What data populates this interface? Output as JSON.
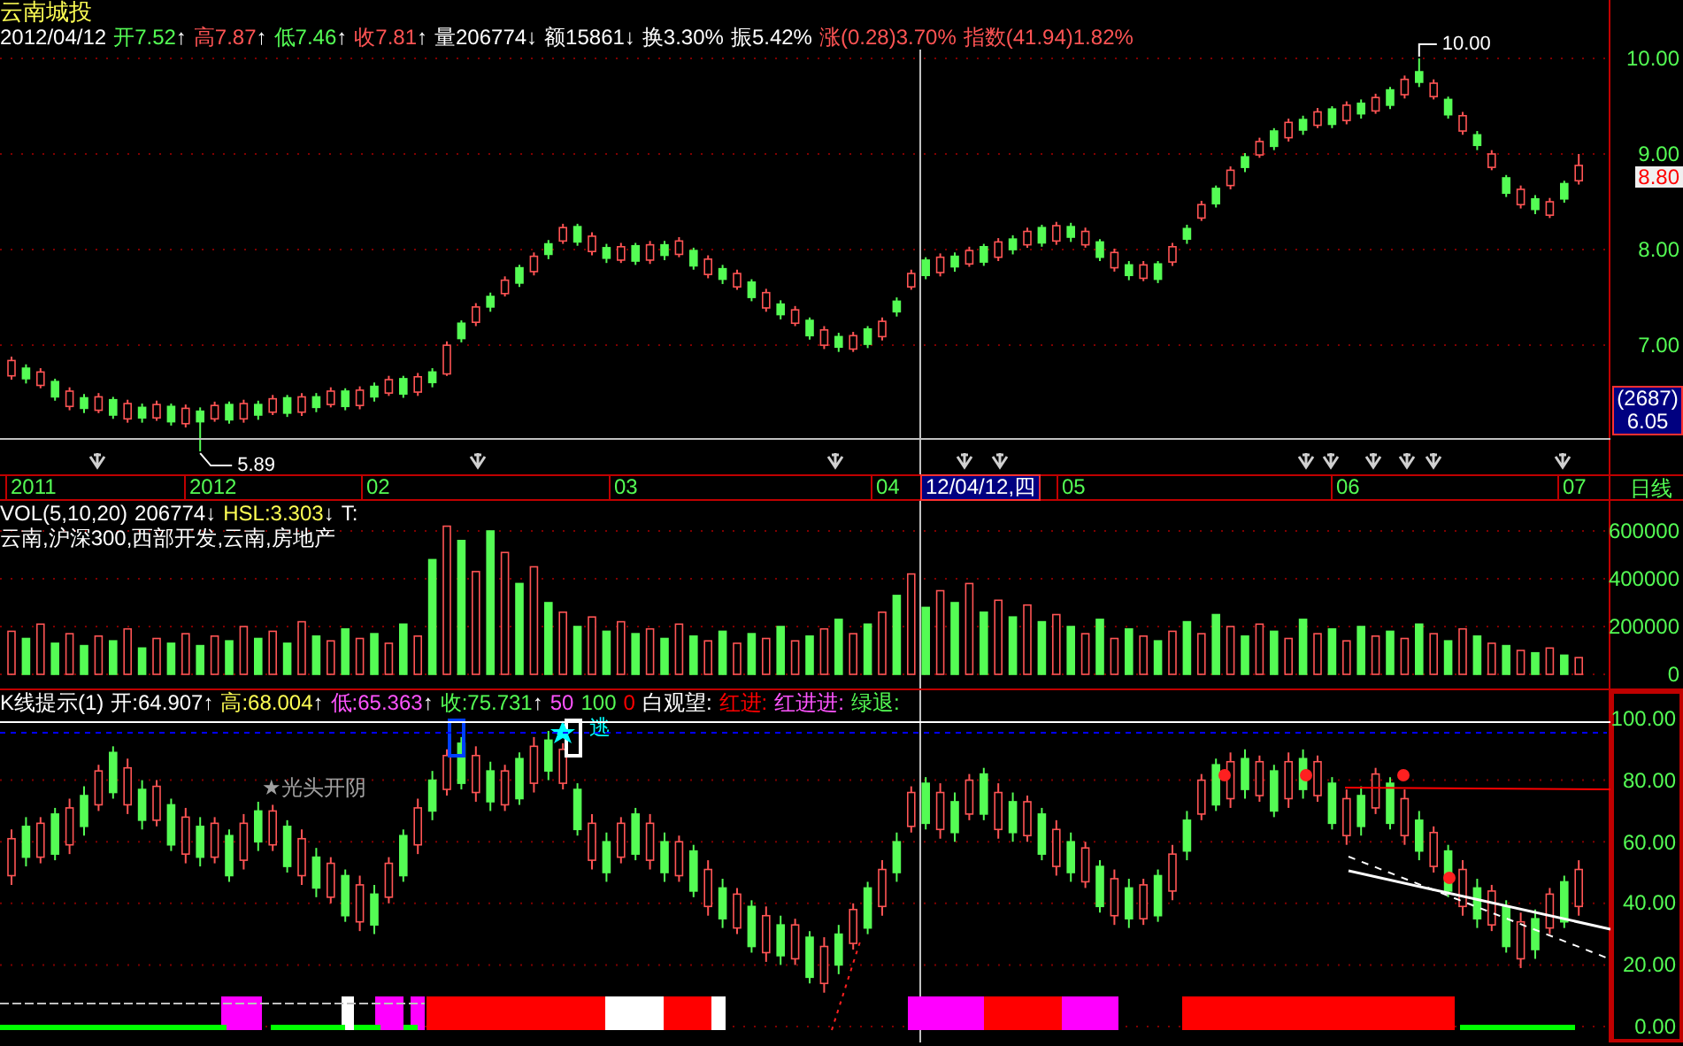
{
  "title": "云南城投",
  "quote": [
    {
      "text": "2012/04/12",
      "color": "#ffffff"
    },
    {
      "text": "开7.52",
      "color": "#54fc54",
      "arrow": "↑"
    },
    {
      "text": "高7.87",
      "color": "#ff5454",
      "arrow": "↑"
    },
    {
      "text": "低7.46",
      "color": "#54fc54",
      "arrow": "↑"
    },
    {
      "text": "收7.81",
      "color": "#ff5454",
      "arrow": "↑"
    },
    {
      "text": "量206774",
      "color": "#ffffff",
      "arrow": "↓"
    },
    {
      "text": "额15861",
      "color": "#ffffff",
      "arrow": "↓"
    },
    {
      "text": "换3.30%",
      "color": "#ffffff"
    },
    {
      "text": "振5.42%",
      "color": "#ffffff"
    },
    {
      "text": "涨(0.28)3.70%",
      "color": "#ff5454"
    },
    {
      "text": "指数(41.94)1.82%",
      "color": "#ff5454"
    }
  ],
  "price": {
    "current": "8.80",
    "info_box": {
      "count": "(2687)",
      "value": "6.05"
    },
    "high_label": "10.00",
    "low_label": "5.89",
    "chart_data": {
      "type": "candlestick",
      "grid": true,
      "ylim": [
        5.65,
        10.61
      ],
      "yticks": [
        {
          "value": 10,
          "label": "10.00"
        },
        {
          "value": 9,
          "label": "9.00"
        },
        {
          "value": 8,
          "label": "8.00"
        },
        {
          "value": 7,
          "label": "7.00"
        }
      ],
      "ohlc": [
        [
          6.68,
          6.88,
          6.64,
          6.84
        ],
        [
          6.76,
          6.8,
          6.6,
          6.65
        ],
        [
          6.58,
          6.76,
          6.55,
          6.72
        ],
        [
          6.62,
          6.65,
          6.42,
          6.46
        ],
        [
          6.36,
          6.56,
          6.32,
          6.52
        ],
        [
          6.45,
          6.49,
          6.29,
          6.34
        ],
        [
          6.32,
          6.5,
          6.29,
          6.46
        ],
        [
          6.43,
          6.46,
          6.23,
          6.27
        ],
        [
          6.23,
          6.43,
          6.19,
          6.39
        ],
        [
          6.35,
          6.39,
          6.19,
          6.24
        ],
        [
          6.24,
          6.42,
          6.21,
          6.38
        ],
        [
          6.36,
          6.39,
          6.16,
          6.2
        ],
        [
          6.18,
          6.38,
          6.14,
          6.34
        ],
        [
          6.31,
          6.35,
          5.89,
          6.2
        ],
        [
          6.23,
          6.41,
          6.2,
          6.37
        ],
        [
          6.38,
          6.41,
          6.18,
          6.22
        ],
        [
          6.23,
          6.43,
          6.19,
          6.39
        ],
        [
          6.38,
          6.42,
          6.22,
          6.27
        ],
        [
          6.3,
          6.48,
          6.27,
          6.44
        ],
        [
          6.45,
          6.48,
          6.25,
          6.29
        ],
        [
          6.3,
          6.5,
          6.26,
          6.46
        ],
        [
          6.46,
          6.5,
          6.3,
          6.35
        ],
        [
          6.38,
          6.56,
          6.35,
          6.52
        ],
        [
          6.52,
          6.55,
          6.32,
          6.36
        ],
        [
          6.37,
          6.57,
          6.33,
          6.53
        ],
        [
          6.57,
          6.61,
          6.41,
          6.46
        ],
        [
          6.5,
          6.68,
          6.47,
          6.64
        ],
        [
          6.65,
          6.68,
          6.45,
          6.49
        ],
        [
          6.51,
          6.71,
          6.47,
          6.67
        ],
        [
          6.72,
          6.76,
          6.56,
          6.61
        ],
        [
          6.7,
          7.04,
          6.68,
          7.0
        ],
        [
          7.23,
          7.26,
          7.03,
          7.07
        ],
        [
          7.24,
          7.44,
          7.2,
          7.4
        ],
        [
          7.51,
          7.55,
          7.35,
          7.4
        ],
        [
          7.54,
          7.72,
          7.51,
          7.68
        ],
        [
          7.81,
          7.84,
          7.61,
          7.65
        ],
        [
          7.77,
          7.97,
          7.73,
          7.93
        ],
        [
          8.06,
          8.1,
          7.9,
          7.95
        ],
        [
          8.09,
          8.27,
          8.06,
          8.23
        ],
        [
          8.24,
          8.27,
          8.04,
          8.08
        ],
        [
          7.98,
          8.18,
          7.94,
          8.14
        ],
        [
          8.02,
          8.06,
          7.86,
          7.91
        ],
        [
          7.89,
          8.07,
          7.86,
          8.03
        ],
        [
          8.04,
          8.07,
          7.84,
          7.88
        ],
        [
          7.89,
          8.09,
          7.85,
          8.05
        ],
        [
          8.05,
          8.09,
          7.89,
          7.94
        ],
        [
          7.95,
          8.13,
          7.92,
          8.09
        ],
        [
          7.99,
          8.02,
          7.79,
          7.83
        ],
        [
          7.74,
          7.94,
          7.7,
          7.9
        ],
        [
          7.8,
          7.84,
          7.64,
          7.69
        ],
        [
          7.61,
          7.79,
          7.58,
          7.75
        ],
        [
          7.66,
          7.69,
          7.46,
          7.5
        ],
        [
          7.39,
          7.59,
          7.35,
          7.55
        ],
        [
          7.43,
          7.47,
          7.27,
          7.32
        ],
        [
          7.23,
          7.41,
          7.2,
          7.37
        ],
        [
          7.26,
          7.29,
          7.06,
          7.1
        ],
        [
          7.0,
          7.2,
          6.96,
          7.16
        ],
        [
          7.09,
          7.13,
          6.93,
          6.98
        ],
        [
          6.96,
          7.14,
          6.93,
          7.1
        ],
        [
          7.17,
          7.2,
          6.97,
          7.01
        ],
        [
          7.09,
          7.29,
          7.05,
          7.25
        ],
        [
          7.46,
          7.5,
          7.3,
          7.35
        ],
        [
          7.61,
          7.79,
          7.58,
          7.75
        ],
        [
          7.89,
          7.92,
          7.69,
          7.73
        ],
        [
          7.76,
          7.96,
          7.72,
          7.92
        ],
        [
          7.93,
          7.97,
          7.77,
          7.82
        ],
        [
          7.85,
          8.03,
          7.82,
          7.99
        ],
        [
          8.03,
          8.06,
          7.83,
          7.87
        ],
        [
          7.92,
          8.12,
          7.88,
          8.08
        ],
        [
          8.11,
          8.15,
          7.95,
          8.0
        ],
        [
          8.05,
          8.23,
          8.02,
          8.19
        ],
        [
          8.23,
          8.26,
          8.03,
          8.07
        ],
        [
          8.09,
          8.29,
          8.05,
          8.25
        ],
        [
          8.24,
          8.28,
          8.08,
          8.13
        ],
        [
          8.05,
          8.23,
          8.02,
          8.19
        ],
        [
          8.08,
          8.11,
          7.88,
          7.92
        ],
        [
          7.81,
          8.01,
          7.77,
          7.97
        ],
        [
          7.84,
          7.88,
          7.68,
          7.73
        ],
        [
          7.7,
          7.88,
          7.67,
          7.84
        ],
        [
          7.85,
          7.88,
          7.65,
          7.69
        ],
        [
          7.87,
          8.07,
          7.83,
          8.03
        ],
        [
          8.22,
          8.26,
          8.06,
          8.11
        ],
        [
          8.33,
          8.51,
          8.3,
          8.47
        ],
        [
          8.64,
          8.67,
          8.44,
          8.48
        ],
        [
          8.67,
          8.87,
          8.63,
          8.83
        ],
        [
          8.97,
          9.01,
          8.81,
          8.86
        ],
        [
          8.99,
          9.17,
          8.96,
          9.13
        ],
        [
          9.24,
          9.27,
          9.04,
          9.08
        ],
        [
          9.17,
          9.37,
          9.13,
          9.33
        ],
        [
          9.36,
          9.4,
          9.2,
          9.25
        ],
        [
          9.3,
          9.48,
          9.27,
          9.44
        ],
        [
          9.47,
          9.5,
          9.27,
          9.31
        ],
        [
          9.35,
          9.55,
          9.31,
          9.51
        ],
        [
          9.53,
          9.57,
          9.37,
          9.42
        ],
        [
          9.45,
          9.63,
          9.42,
          9.59
        ],
        [
          9.67,
          9.7,
          9.47,
          9.51
        ],
        [
          9.62,
          9.82,
          9.58,
          9.78
        ],
        [
          9.86,
          10.0,
          9.7,
          9.75
        ],
        [
          9.6,
          9.78,
          9.57,
          9.74
        ],
        [
          9.57,
          9.6,
          9.37,
          9.41
        ],
        [
          9.24,
          9.44,
          9.2,
          9.4
        ],
        [
          9.2,
          9.24,
          9.04,
          9.09
        ],
        [
          8.86,
          9.04,
          8.83,
          9.0
        ],
        [
          8.75,
          8.78,
          8.55,
          8.59
        ],
        [
          8.47,
          8.67,
          8.43,
          8.63
        ],
        [
          8.53,
          8.57,
          8.37,
          8.42
        ],
        [
          8.36,
          8.54,
          8.33,
          8.5
        ],
        [
          8.69,
          8.72,
          8.49,
          8.53
        ],
        [
          8.72,
          9.0,
          8.68,
          8.88
        ]
      ]
    }
  },
  "date_axis": {
    "labels": [
      "2011",
      "2012",
      "02",
      "03",
      "04",
      "05",
      "06",
      "07"
    ],
    "cursor": "12/04/12,四",
    "period": "日线"
  },
  "volume": {
    "header": [
      {
        "text": "VOL(5,10,20)",
        "color": "#ffffff"
      },
      {
        "text": "206774",
        "color": "#ffffff",
        "arrow": "↓"
      },
      {
        "text": "HSL:3.303",
        "color": "#ffff54",
        "arrow": "↓"
      },
      {
        "text": "T:",
        "color": "#ffffff"
      }
    ],
    "sectors": "云南,沪深300,西部开发,云南,房地产",
    "chart_data": {
      "type": "bar",
      "grid": true,
      "ylim": [
        -59259,
        725926
      ],
      "yticks": [
        {
          "value": 600000,
          "label": "600000"
        },
        {
          "value": 400000,
          "label": "400000"
        },
        {
          "value": 200000,
          "label": "200000"
        },
        {
          "value": 0,
          "label": "0"
        }
      ],
      "values": [
        180000,
        150000,
        210000,
        130000,
        170000,
        120000,
        160000,
        140000,
        190000,
        110000,
        150000,
        130000,
        170000,
        120000,
        160000,
        140000,
        200000,
        150000,
        180000,
        130000,
        220000,
        160000,
        140000,
        190000,
        150000,
        170000,
        130000,
        210000,
        160000,
        480000,
        620000,
        560000,
        430000,
        600000,
        510000,
        380000,
        450000,
        300000,
        260000,
        200000,
        240000,
        180000,
        220000,
        170000,
        190000,
        150000,
        210000,
        160000,
        140000,
        180000,
        130000,
        170000,
        150000,
        200000,
        140000,
        160000,
        190000,
        230000,
        170000,
        210000,
        260000,
        330000,
        420000,
        280000,
        350000,
        300000,
        380000,
        260000,
        310000,
        240000,
        290000,
        220000,
        250000,
        200000,
        170000,
        230000,
        150000,
        190000,
        160000,
        140000,
        180000,
        220000,
        170000,
        250000,
        200000,
        160000,
        210000,
        180000,
        150000,
        230000,
        170000,
        190000,
        140000,
        200000,
        160000,
        180000,
        150000,
        210000,
        170000,
        140000,
        190000,
        160000,
        130000,
        120000,
        100000,
        90000,
        110000,
        80000,
        70000
      ]
    }
  },
  "indicator": {
    "header": [
      {
        "text": "K线提示(1)",
        "color": "#ffffff"
      },
      {
        "text": "开:64.907",
        "color": "#ffffff",
        "arrow": "↑"
      },
      {
        "text": "高:68.004",
        "color": "#ffff54",
        "arrow": "↑"
      },
      {
        "text": "低:65.363",
        "color": "#ff54ff",
        "arrow": "↑"
      },
      {
        "text": "收:75.731",
        "color": "#54fc54",
        "arrow": "↑"
      },
      {
        "text": "50",
        "color": "#ff54ff"
      },
      {
        "text": "100",
        "color": "#54fc54"
      },
      {
        "text": "0",
        "color": "#ff0000"
      },
      {
        "text": "白观望:",
        "color": "#ffffff"
      },
      {
        "text": "红进:",
        "color": "#ff0000"
      },
      {
        "text": "红进进:",
        "color": "#ff54ff"
      },
      {
        "text": "绿退:",
        "color": "#54fc54"
      }
    ],
    "pattern_label": "★光头开阴",
    "signal_label": "逃",
    "chart_data": {
      "type": "candlestick",
      "grid": true,
      "ylim": [
        -5.17,
        109.2
      ],
      "yticks": [
        {
          "value": 100,
          "label": "100.00"
        },
        {
          "value": 80,
          "label": "80.00"
        },
        {
          "value": 60,
          "label": "60.00"
        },
        {
          "value": 40,
          "label": "40.00"
        },
        {
          "value": 20,
          "label": "20.00"
        },
        {
          "value": 0,
          "label": "0.00"
        }
      ],
      "ohlc": [
        [
          49,
          64,
          46,
          61
        ],
        [
          65,
          68,
          52,
          55
        ],
        [
          55,
          68,
          53,
          66
        ],
        [
          69,
          71,
          54,
          56
        ],
        [
          59,
          74,
          56,
          71
        ],
        [
          75,
          78,
          62,
          65
        ],
        [
          72,
          85,
          70,
          83
        ],
        [
          89,
          91,
          74,
          76
        ],
        [
          72,
          87,
          69,
          84
        ],
        [
          77,
          80,
          64,
          67
        ],
        [
          67,
          80,
          65,
          78
        ],
        [
          72,
          74,
          57,
          59
        ],
        [
          56,
          71,
          53,
          68
        ],
        [
          65,
          68,
          52,
          55
        ],
        [
          55,
          68,
          53,
          66
        ],
        [
          62,
          64,
          47,
          49
        ],
        [
          54,
          69,
          51,
          66
        ],
        [
          70,
          73,
          57,
          60
        ],
        [
          59,
          72,
          57,
          70
        ],
        [
          65,
          67,
          50,
          52
        ],
        [
          49,
          64,
          46,
          61
        ],
        [
          55,
          58,
          42,
          45
        ],
        [
          42,
          55,
          40,
          53
        ],
        [
          49,
          51,
          34,
          36
        ],
        [
          34,
          49,
          31,
          46
        ],
        [
          43,
          46,
          30,
          33
        ],
        [
          42,
          55,
          40,
          53
        ],
        [
          62,
          64,
          47,
          49
        ],
        [
          59,
          74,
          56,
          71
        ],
        [
          80,
          83,
          67,
          70
        ],
        [
          77,
          90,
          75,
          88
        ],
        [
          92,
          94,
          77,
          79
        ],
        [
          76,
          91,
          73,
          88
        ],
        [
          83,
          86,
          70,
          73
        ],
        [
          72,
          85,
          70,
          83
        ],
        [
          87,
          89,
          72,
          74
        ],
        [
          79,
          94,
          76,
          91
        ],
        [
          93,
          96,
          80,
          83
        ],
        [
          79,
          92,
          77,
          90
        ],
        [
          77,
          79,
          62,
          64
        ],
        [
          54,
          69,
          51,
          66
        ],
        [
          60,
          63,
          47,
          50
        ],
        [
          55,
          68,
          53,
          66
        ],
        [
          69,
          71,
          54,
          56
        ],
        [
          54,
          69,
          51,
          66
        ],
        [
          60,
          63,
          47,
          50
        ],
        [
          49,
          62,
          47,
          60
        ],
        [
          57,
          59,
          42,
          44
        ],
        [
          39,
          54,
          36,
          51
        ],
        [
          45,
          48,
          32,
          35
        ],
        [
          32,
          45,
          30,
          43
        ],
        [
          39,
          41,
          24,
          26
        ],
        [
          24,
          39,
          21,
          36
        ],
        [
          33,
          36,
          20,
          23
        ],
        [
          22,
          35,
          20,
          33
        ],
        [
          29,
          31,
          14,
          16
        ],
        [
          14,
          29,
          11,
          26
        ],
        [
          30,
          33,
          17,
          20
        ],
        [
          27,
          40,
          25,
          38
        ],
        [
          45,
          47,
          30,
          32
        ],
        [
          39,
          54,
          36,
          51
        ],
        [
          60,
          63,
          47,
          50
        ],
        [
          65,
          78,
          63,
          76
        ],
        [
          79,
          81,
          64,
          66
        ],
        [
          64,
          79,
          61,
          76
        ],
        [
          73,
          76,
          60,
          63
        ],
        [
          69,
          82,
          67,
          80
        ],
        [
          82,
          84,
          67,
          69
        ],
        [
          64,
          79,
          61,
          76
        ],
        [
          73,
          76,
          60,
          63
        ],
        [
          62,
          75,
          60,
          73
        ],
        [
          69,
          71,
          54,
          56
        ],
        [
          52,
          67,
          49,
          64
        ],
        [
          60,
          63,
          47,
          50
        ],
        [
          47,
          60,
          45,
          58
        ],
        [
          52,
          54,
          37,
          39
        ],
        [
          36,
          51,
          33,
          48
        ],
        [
          45,
          48,
          32,
          35
        ],
        [
          35,
          48,
          33,
          46
        ],
        [
          49,
          51,
          34,
          36
        ],
        [
          44,
          59,
          41,
          56
        ],
        [
          67,
          70,
          54,
          57
        ],
        [
          69,
          82,
          67,
          80
        ],
        [
          85,
          87,
          70,
          72
        ],
        [
          74,
          89,
          71,
          86
        ],
        [
          87,
          90,
          74,
          77
        ],
        [
          75,
          88,
          73,
          86
        ],
        [
          83,
          85,
          68,
          70
        ],
        [
          74,
          89,
          71,
          86
        ],
        [
          87,
          90,
          74,
          77
        ],
        [
          75,
          88,
          73,
          86
        ],
        [
          79,
          81,
          64,
          66
        ],
        [
          62,
          77,
          59,
          74
        ],
        [
          75,
          78,
          62,
          65
        ],
        [
          71,
          84,
          69,
          82
        ],
        [
          79,
          81,
          64,
          66
        ],
        [
          62,
          77,
          59,
          74
        ],
        [
          67,
          70,
          54,
          57
        ],
        [
          52,
          65,
          50,
          63
        ],
        [
          57,
          59,
          42,
          44
        ],
        [
          39,
          54,
          36,
          51
        ],
        [
          45,
          48,
          32,
          35
        ],
        [
          33,
          46,
          31,
          44
        ],
        [
          39,
          41,
          24,
          26
        ],
        [
          22,
          37,
          19,
          34
        ],
        [
          35,
          38,
          22,
          25
        ],
        [
          32,
          45,
          30,
          43
        ],
        [
          47,
          49,
          32,
          34
        ],
        [
          39,
          54,
          36,
          51
        ]
      ]
    }
  }
}
